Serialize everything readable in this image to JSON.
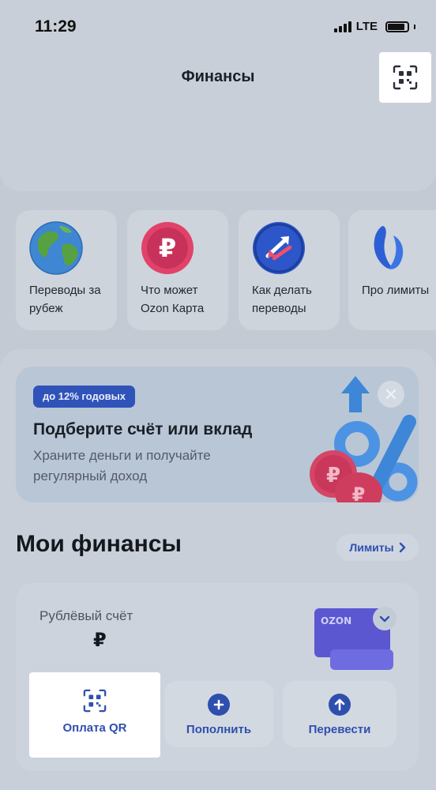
{
  "status_bar": {
    "time": "11:29",
    "network": "LTE"
  },
  "header": {
    "title": "Финансы",
    "qr_icon": "qr-scan-icon"
  },
  "stories": [
    {
      "label": "Переводы за рубеж",
      "icon": "globe-icon"
    },
    {
      "label": "Что может Ozon Карта",
      "icon": "ruble-coin-icon"
    },
    {
      "label": "Как делать переводы",
      "icon": "transfer-arrows-icon"
    },
    {
      "label": "Про лимиты",
      "icon": "limits-icon"
    }
  ],
  "promo": {
    "badge": "до 12% годовых",
    "title": "Подберите счёт или вклад",
    "text": "Храните деньги и получайте регулярный доход",
    "close_icon": "close-icon"
  },
  "my_finances": {
    "title": "Мои финансы",
    "limits_label": "Лимиты",
    "account": {
      "name": "Рублёвый счёт",
      "balance": "₽",
      "card_brand": "OZON"
    },
    "actions": [
      {
        "label": "Оплата QR",
        "icon": "qr-scan-icon"
      },
      {
        "label": "Пополнить",
        "icon": "plus-icon"
      },
      {
        "label": "Перевести",
        "icon": "arrow-up-icon"
      }
    ]
  },
  "colors": {
    "accent": "#2f4fae",
    "background": "#c3cad4",
    "badge": "#2f53b8"
  }
}
